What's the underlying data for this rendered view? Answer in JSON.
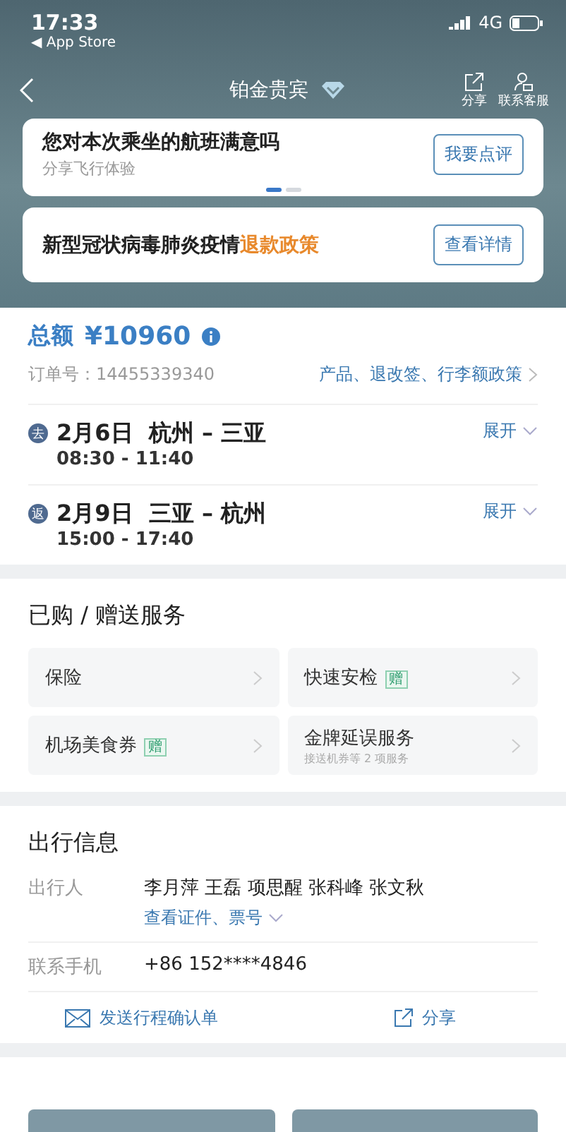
{
  "status_bar": {
    "time": "17:33",
    "back_app": "◀ App Store",
    "network": "4G"
  },
  "nav": {
    "title": "铂金贵宾",
    "actions": [
      {
        "kind": "share",
        "label": "分享"
      },
      {
        "kind": "service",
        "label": "联系客服"
      }
    ]
  },
  "banner": {
    "title": "您对本次乘坐的航班满意吗",
    "subtitle": "分享飞行体验",
    "button": "我要点评",
    "pager": [
      {
        "selected": true
      },
      {
        "selected": false
      }
    ]
  },
  "notice": {
    "text": "新型冠状病毒肺炎疫情",
    "highlight": "退款政策",
    "button": "查看详情"
  },
  "order": {
    "total_label": "总额",
    "total": "¥10960",
    "order_no": "订单号：14455339340",
    "policy_link": "产品、退改签、行李额政策"
  },
  "trips": [
    {
      "tag": "去",
      "date": "2月6日",
      "from": "杭州",
      "sep": "–",
      "to": "三亚",
      "time": "08:30 - 11:40",
      "expand": "展开"
    },
    {
      "tag": "返",
      "date": "2月9日",
      "from": "三亚",
      "sep": "–",
      "to": "杭州",
      "time": "15:00 - 17:40",
      "expand": "展开"
    }
  ],
  "services": {
    "title": "已购 / 赠送服务",
    "items": [
      {
        "label": "保险"
      },
      {
        "label": "快速安检",
        "badge": "赠"
      },
      {
        "label": "机场美食券",
        "badge": "赠"
      },
      {
        "label": "金牌延误服务",
        "subtitle": "接送机券等 2 项服务"
      }
    ]
  },
  "travel_info": {
    "title": "出行信息",
    "rows": [
      {
        "label": "出行人",
        "value": "李月萍 王磊 项思醒 张科峰 张文秋",
        "link": "查看证件、票号"
      },
      {
        "label": "联系手机",
        "value": "+86 152****4846"
      }
    ],
    "actions": [
      {
        "kind": "mail",
        "label": "发送行程确认单"
      },
      {
        "kind": "share",
        "label": "分享"
      }
    ]
  }
}
